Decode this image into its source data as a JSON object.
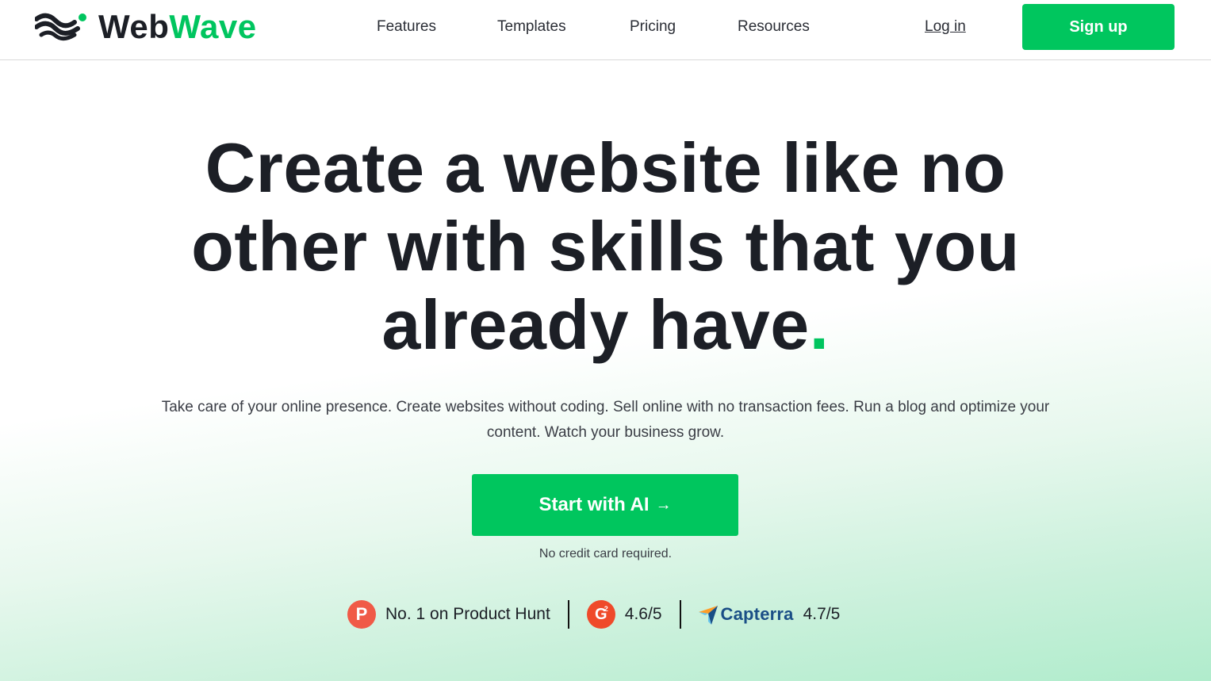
{
  "brand": {
    "name_part1": "Web",
    "name_part2": "Wave",
    "logo_icon": "wave-logo-icon",
    "colors": {
      "accent": "#00c55f",
      "dark": "#1c1f26"
    }
  },
  "nav": {
    "items": [
      {
        "label": "Features"
      },
      {
        "label": "Templates"
      },
      {
        "label": "Pricing"
      },
      {
        "label": "Resources"
      }
    ],
    "login_label": "Log in",
    "signup_label": "Sign up"
  },
  "hero": {
    "title_line1": "Create a website like no",
    "title_line2": "other with skills that you",
    "title_line3": "already have",
    "title_dot": ".",
    "subtitle": "Take care of your online presence. Create websites without coding. Sell online with no transaction fees. Run a blog and optimize your content. Watch your business grow.",
    "cta_label": "Start with AI",
    "cta_icon": "arrow-right-icon",
    "cta_arrow": "→",
    "note": "No credit card required."
  },
  "ratings": [
    {
      "icon": "product-hunt-icon",
      "glyph": "P",
      "text": "No. 1 on Product Hunt"
    },
    {
      "icon": "g2-icon",
      "glyph": "G",
      "sup": "2",
      "text": "4.6/5"
    },
    {
      "icon": "capterra-icon",
      "name": "Capterra",
      "text": "4.7/5"
    }
  ]
}
